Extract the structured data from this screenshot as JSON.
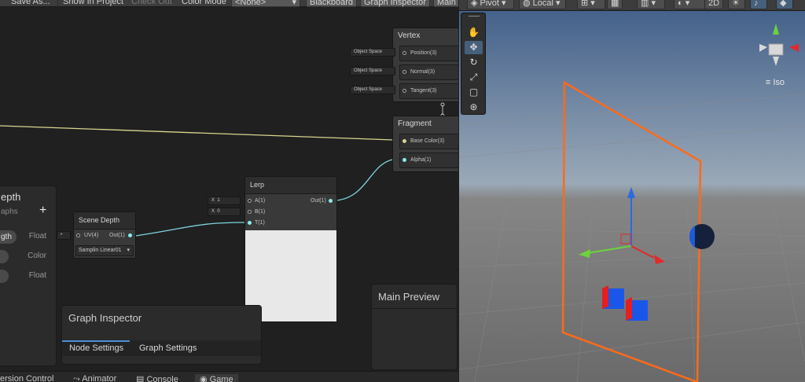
{
  "graph_toolbar": {
    "save_as": "Save As...",
    "show_in_project": "Show In Project",
    "check_out": "Check Out",
    "color_mode_label": "Color Mode",
    "color_mode_value": "<None>",
    "blackboard": "Blackboard",
    "graph_inspector": "Graph Inspector",
    "main_preview": "Main"
  },
  "vertex": {
    "title": "Vertex",
    "ports": [
      "Position(3)",
      "Normal(3)",
      "Tangent(3)"
    ],
    "inputs": [
      "Object Space",
      "Object Space",
      "Object Space"
    ]
  },
  "fragment": {
    "title": "Fragment",
    "ports": [
      "Base Color(3)",
      "Alpha(1)"
    ]
  },
  "lerp": {
    "title": "Lerp",
    "in_a": "A(1)",
    "in_b": "B(1)",
    "in_t": "T(1)",
    "out": "Out(1)",
    "a_label": "X",
    "a_value": "1",
    "b_label": "X",
    "b_value": "0"
  },
  "scene_depth": {
    "title": "Scene Depth",
    "in_uv": "UV(4)",
    "out": "Out(1)",
    "sampling_label": "Samplin",
    "sampling_value": "Linear01"
  },
  "blackboard": {
    "title_partial": "epth",
    "subtitle_partial": "aphs",
    "add": "+",
    "properties": [
      {
        "name": "gth",
        "type": "Float"
      },
      {
        "name": "",
        "type": "Color"
      },
      {
        "name": "",
        "type": "Float"
      }
    ]
  },
  "graph_inspector": {
    "title": "Graph Inspector",
    "tabs": [
      "Node Settings",
      "Graph Settings"
    ]
  },
  "main_preview": {
    "title": "Main Preview"
  },
  "bottom_tabs": [
    "ersion Control",
    "Animator",
    "Console",
    "Game"
  ],
  "scene_toolbar": {
    "pivot": "Pivot",
    "local": "Local",
    "mode_2d": "2D"
  },
  "scene_gizmo": {
    "projection": "Iso"
  },
  "colors": {
    "selection_outline": "#ff6a1a",
    "axis_x": "#e22a2a",
    "axis_y": "#6cd33c",
    "axis_z": "#2a6ae2",
    "wire_color": "#d8d58f",
    "wire_float": "#7ed3e0"
  }
}
